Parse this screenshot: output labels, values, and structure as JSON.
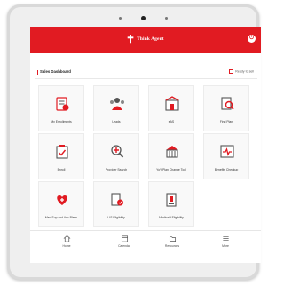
{
  "app": {
    "brand": "Think Agent",
    "accent_color": "#e11b22",
    "header_action_icon": "exit-icon"
  },
  "dashboard": {
    "title": "Sales Dashboard",
    "ready_label": "Ready to sell"
  },
  "tiles": [
    {
      "label": "My Enrollments",
      "icon": "enrollments-icon"
    },
    {
      "label": "Leads",
      "icon": "leads-icon"
    },
    {
      "label": "eAS",
      "icon": "eas-icon"
    },
    {
      "label": "Find Plan",
      "icon": "find-plan-icon"
    },
    {
      "label": "Enroll",
      "icon": "enroll-icon"
    },
    {
      "label": "Provider Search",
      "icon": "provider-search-icon"
    },
    {
      "label": "YoY Plan Change Tool",
      "icon": "plan-change-icon"
    },
    {
      "label": "Benefits Checkup",
      "icon": "benefits-checkup-icon"
    },
    {
      "label": "Med Sup and Anc Plans",
      "icon": "med-sup-icon"
    },
    {
      "label": "LIS Eligibility",
      "icon": "lis-eligibility-icon"
    },
    {
      "label": "Medicaid Eligibility",
      "icon": "medicaid-eligibility-icon"
    }
  ],
  "nav": [
    {
      "label": "Home",
      "icon": "home-icon"
    },
    {
      "label": "Calendar",
      "icon": "calendar-icon"
    },
    {
      "label": "Resources",
      "icon": "resources-icon"
    },
    {
      "label": "More",
      "icon": "menu-icon"
    }
  ]
}
